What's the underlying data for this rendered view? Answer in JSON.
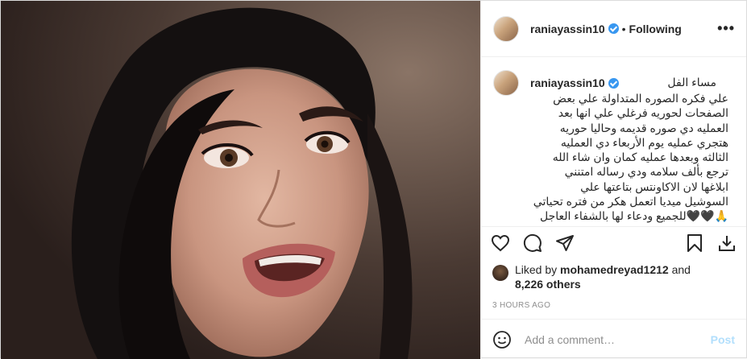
{
  "post": {
    "username": "raniayassin10",
    "follow_separator": "•",
    "follow_status": "Following",
    "more_label": "•••",
    "caption_first_line": "مساء الفل",
    "caption_body": "علي فكره الصوره المتداولة علي بعض\nالصفحات لحوريه فرغلي علي انها بعد\nالعمليه دي صوره قديمه وحاليا حوريه\nهتجري عمليه يوم الأربعاء دي العمليه\nالثالثه وبعدها عمليه كمان وان شاء الله\nترجع بألف سلامه ودي رساله امتنني\nابلاغها لان الاكاونتس بتاعتها علي\nالسوشيل ميديا اتعمل هكر من فتره تحياتي\n🙏🖤🖤للجميع ودعاء لها بالشفاء العاجل",
    "likes": {
      "prefix": "Liked by ",
      "user": "mohamedreyad1212",
      "middle": " and",
      "others": "8,226 others"
    },
    "timestamp": "3 HOURS AGO",
    "comment_placeholder": "Add a comment…",
    "post_button": "Post"
  },
  "icons": {
    "verified": "verified-badge-icon",
    "like": "heart-icon",
    "comment": "comment-icon",
    "share": "share-icon",
    "save": "bookmark-icon",
    "download": "download-icon",
    "emoji": "emoji-icon"
  },
  "colors": {
    "verified": "#3897f0",
    "post_button": "#b2dffc",
    "muted": "#8e8e8e"
  }
}
